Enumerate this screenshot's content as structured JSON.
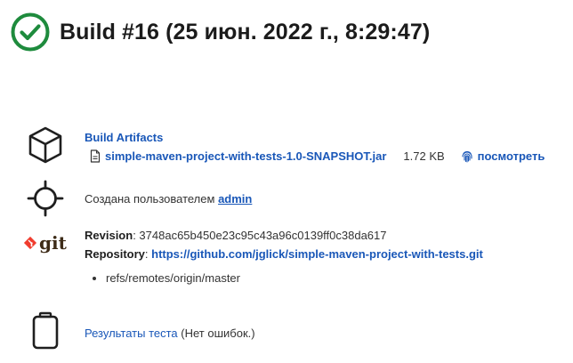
{
  "build": {
    "title": "Build #16 (25 июн. 2022 г., 8:29:47)",
    "status_color": "#1e8b3d"
  },
  "artifacts": {
    "heading": "Build Artifacts",
    "file_name": "simple-maven-project-with-tests-1.0-SNAPSHOT.jar",
    "file_size": "1.72 KB",
    "view_label": "посмотреть",
    "icon": "cube-icon"
  },
  "cause": {
    "prefix": "Создана пользователем",
    "user": "admin",
    "icon": "crosshair-icon"
  },
  "git": {
    "icon_text": "git",
    "icon_color": "#f03c2e",
    "revision_label": "Revision",
    "revision_value": "3748ac65b450e23c95c43a96c0139ff0c38da617",
    "repository_label": "Repository",
    "repository_url": "https://github.com/jglick/simple-maven-project-with-tests.git",
    "branches": [
      "refs/remotes/origin/master"
    ]
  },
  "tests": {
    "link_label": "Результаты теста",
    "summary": "(Нет ошибок.)",
    "icon": "clipboard-icon"
  },
  "colors": {
    "link": "#1957b8",
    "success": "#1e8b3d"
  }
}
